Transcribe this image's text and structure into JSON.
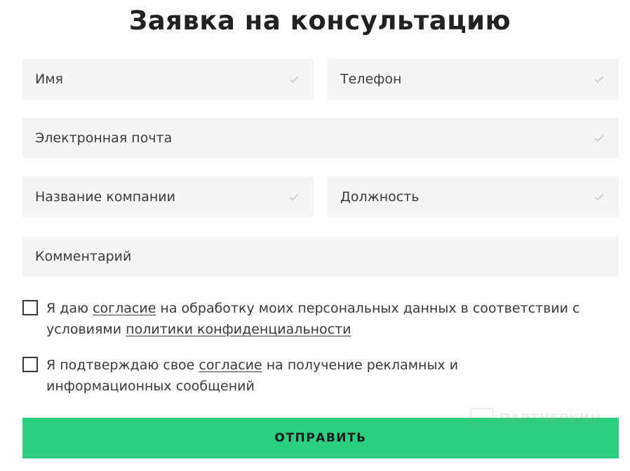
{
  "title": "Заявка на консультацию",
  "fields": {
    "name": "Имя",
    "phone": "Телефон",
    "email": "Электронная почта",
    "company": "Название компании",
    "position": "Должность",
    "comment": "Комментарий"
  },
  "consent1": {
    "before": "Я даю ",
    "link1": "согласие",
    "middle": " на обработку моих персональных данных в соответствии с условиями ",
    "link2": "политики конфиденциальности"
  },
  "consent2": {
    "before": "Я подтверждаю свое ",
    "link1": "согласие",
    "after": " на получение рекламных и информационных сообщений"
  },
  "submit_label": "ОТПРАВИТЬ",
  "watermark_text": "ПАРТНЕРКИН",
  "colors": {
    "accent": "#2ccf7f",
    "field_bg": "#f5f5f5",
    "check": "#c8c8c8"
  },
  "icons": {
    "field_valid": "check-icon",
    "watermark": "logo"
  }
}
